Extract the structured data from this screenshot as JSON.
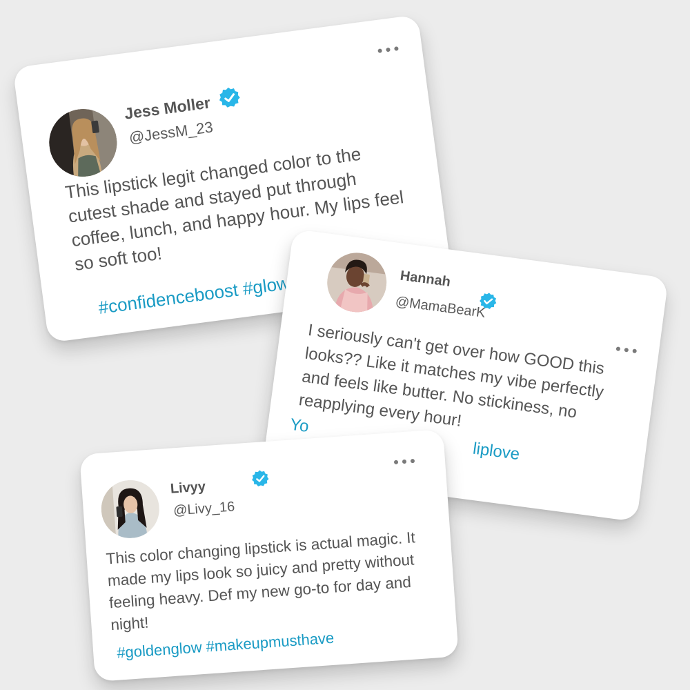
{
  "hashtag_color": "#1a9bc4",
  "verified_color": "#29b6e8",
  "posts": [
    {
      "name": "Jess Moller",
      "handle": "@JessM_23",
      "body": "This lipstick legit changed color to the cutest shade and stayed put through coffee, lunch, and happy hour. My lips feel so soft too!",
      "hashtags": "#confidenceboost #glowvib",
      "avatar_icon": "profile-photo"
    },
    {
      "name": "Hannah",
      "handle": "@MamaBearK",
      "body": "I seriously can't get over how GOOD this looks?? Like it matches my vibe perfectly and feels like butter. No stickiness, no reapplying every hour!",
      "hashtags": "Yo                                    liplove",
      "avatar_icon": "profile-photo"
    },
    {
      "name": "Livyy",
      "handle": "@Livy_16",
      "body": "This color changing lipstick is actual magic. It made my lips look so juicy and pretty without feeling heavy. Def my new go-to for day and night!",
      "hashtags": "#goldenglow #makeupmusthave",
      "avatar_icon": "profile-photo"
    }
  ]
}
